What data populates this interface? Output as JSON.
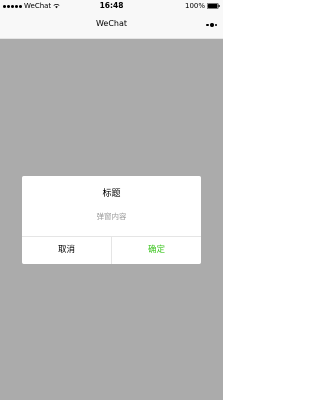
{
  "status_bar": {
    "carrier": "WeChat",
    "time": "16:48",
    "battery": "100%",
    "signal_icon": "signal-dots-icon",
    "wifi_icon": "wifi-icon",
    "battery_icon": "battery-icon"
  },
  "nav": {
    "title": "WeChat",
    "menu_icon": "more-dots-icon"
  },
  "modal": {
    "title": "标题",
    "content": "弹窗内容",
    "cancel_label": "取消",
    "confirm_label": "确定",
    "confirm_color": "#3cc51f",
    "mask_color": "#a9a9a9"
  }
}
